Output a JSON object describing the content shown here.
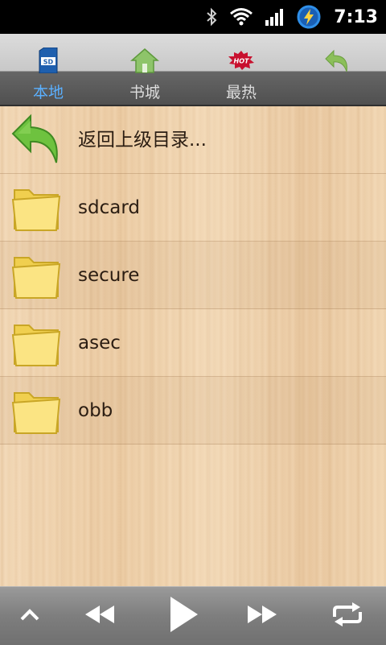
{
  "status_bar": {
    "time": "7:13",
    "icons": [
      "bluetooth-icon",
      "wifi-icon",
      "signal-icon",
      "battery-charging-icon"
    ]
  },
  "tabs": [
    {
      "label": "本地",
      "icon": "sd-card-icon",
      "active": true
    },
    {
      "label": "书城",
      "icon": "home-icon",
      "active": false
    },
    {
      "label": "最热",
      "icon": "hot-badge-icon",
      "active": false,
      "badge_text": "HOT"
    },
    {
      "label": "",
      "icon": "back-arrow-icon",
      "active": false
    }
  ],
  "file_list": {
    "items": [
      {
        "label": "返回上级目录...",
        "icon": "back-arrow-icon"
      },
      {
        "label": "sdcard",
        "icon": "folder-icon"
      },
      {
        "label": "secure",
        "icon": "folder-icon"
      },
      {
        "label": "asec",
        "icon": "folder-icon"
      },
      {
        "label": "obb",
        "icon": "folder-icon"
      }
    ]
  },
  "player": {
    "buttons": [
      "chevron-up-icon",
      "rewind-icon",
      "play-icon",
      "fast-forward-icon",
      "repeat-icon"
    ]
  },
  "colors": {
    "active_tab": "#5ab0ff",
    "wood": "#f0d4b0",
    "folder": "#f7dc6f",
    "arrow_green": "#6ec23f"
  }
}
